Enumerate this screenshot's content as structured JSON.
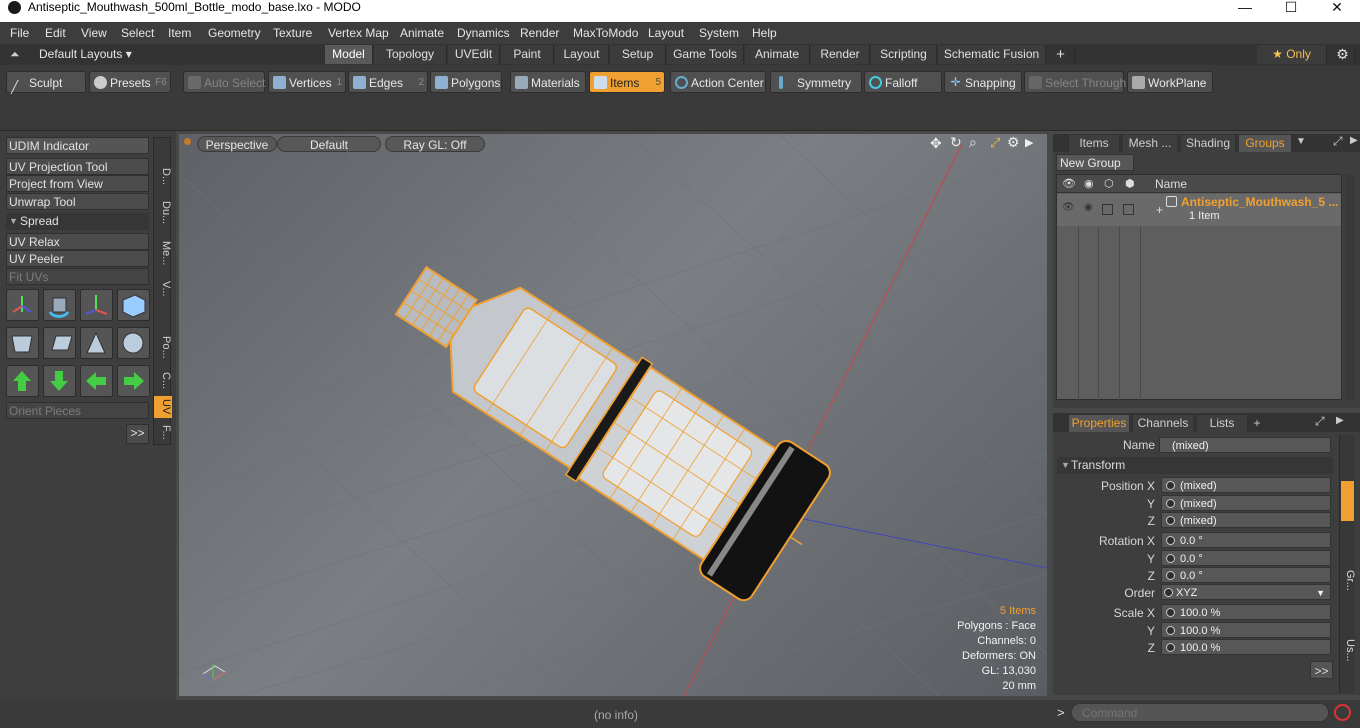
{
  "window": {
    "title": "Antiseptic_Mouthwash_500ml_Bottle_modo_base.lxo - MODO",
    "minimize": "—",
    "maximize": "☐",
    "close": "✕"
  },
  "menubar": {
    "items": [
      "File",
      "Edit",
      "View",
      "Select",
      "Item",
      "Geometry",
      "Texture",
      "Vertex Map",
      "Animate",
      "Dynamics",
      "Render",
      "MaxToModo",
      "Layout",
      "System",
      "Help"
    ]
  },
  "layoutbar": {
    "layouts_label": "Default Layouts ▾",
    "tabs": [
      "Model",
      "Topology",
      "UVEdit",
      "Paint",
      "Layout",
      "Setup",
      "Game Tools",
      "Animate",
      "Render",
      "Scripting",
      "Schematic Fusion",
      "+"
    ],
    "only_label": "★  Only",
    "gear": "⚙"
  },
  "toolbar": {
    "sculpt": "Sculpt",
    "presets": "Presets",
    "presets_key": "F6",
    "auto_select": "Auto Select",
    "vertices": "Vertices",
    "vertices_key": "1",
    "edges": "Edges",
    "edges_key": "2",
    "polygons": "Polygons",
    "materials": "Materials",
    "items": "Items",
    "items_key": "5",
    "action_center": "Action Center",
    "symmetry": "Symmetry",
    "falloff": "Falloff",
    "snapping": "Snapping",
    "select_through": "Select Through",
    "workplane": "WorkPlane"
  },
  "leftpanel": {
    "udim": "UDIM Indicator",
    "uv_projection": "UV Projection Tool",
    "project_from_view": "Project from View",
    "unwrap": "Unwrap Tool",
    "spread": "Spread",
    "uv_relax": "UV Relax",
    "uv_peeler": "UV Peeler",
    "fit_uvs": "Fit UVs",
    "orient_pieces": "Orient Pieces",
    "more": ">>",
    "vtabs": [
      "D...",
      "Du...",
      "Me...",
      "V...",
      "Po...",
      "C...",
      "UV",
      "F..."
    ]
  },
  "viewport": {
    "perspective": "Perspective",
    "default": "Default",
    "raygl": "Ray GL: Off",
    "info": {
      "items": "5 Items",
      "polygons": "Polygons : Face",
      "channels": "Channels: 0",
      "deformers": "Deformers: ON",
      "gl": "GL: 13,030",
      "scale": "20 mm"
    }
  },
  "rightpanel": {
    "tabs": [
      "Items",
      "Mesh ...",
      "Shading",
      "Groups"
    ],
    "new_group": "New Group",
    "col_name": "Name",
    "group_name": "Antiseptic_Mouthwash_5 ...",
    "group_count": "1 Item"
  },
  "properties": {
    "tabs": [
      "Properties",
      "Channels",
      "Lists",
      "+"
    ],
    "name_label": "Name",
    "name_value": "(mixed)",
    "transform": "Transform",
    "position_x_label": "Position X",
    "y_label": "Y",
    "z_label": "Z",
    "pos_x": "(mixed)",
    "pos_y": "(mixed)",
    "pos_z": "(mixed)",
    "rotation_x_label": "Rotation X",
    "rot_x": "0.0 °",
    "rot_y": "0.0 °",
    "rot_z": "0.0 °",
    "order_label": "Order",
    "order_value": "XYZ",
    "scale_x_label": "Scale X",
    "scale_x": "100.0 %",
    "scale_y": "100.0 %",
    "scale_z": "100.0 %",
    "more": ">>",
    "side_tabs": [
      "Gr...",
      "Us..."
    ]
  },
  "status": {
    "info": "(no info)",
    "prompt": ">",
    "command_placeholder": "Command"
  },
  "colors": {
    "accent": "#f0a030",
    "wire": "#f0a030"
  }
}
